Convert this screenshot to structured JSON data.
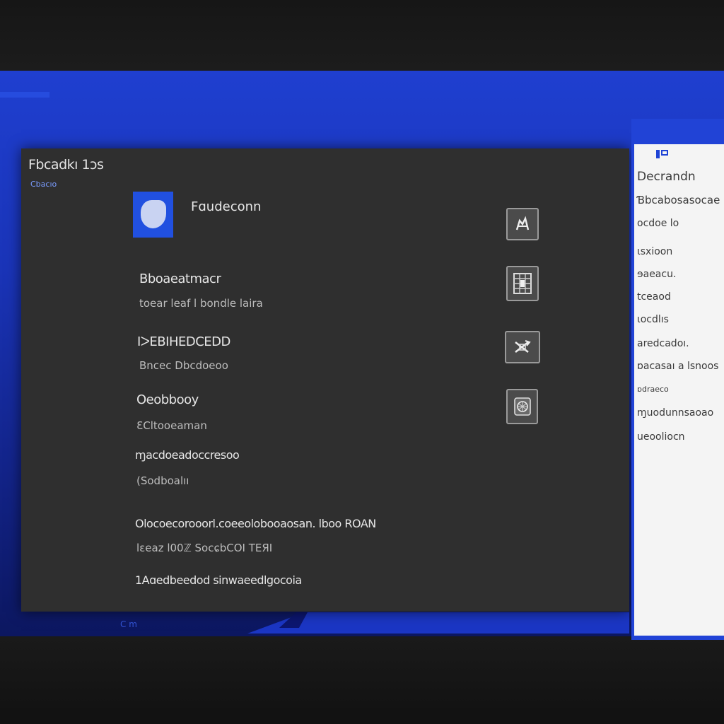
{
  "panel": {
    "title": "Fbcadkı 1ɔs",
    "subtitle": "Cbacıo"
  },
  "account": {
    "name": "Fɑudeconn"
  },
  "rows": [
    {
      "title": "Bboaeatmacr",
      "desc": "toear leaf l bondle laira",
      "icon": "edit-icon"
    },
    {
      "title": "IᐳEBIHEDCEDD",
      "desc": "Bncec Dbcdoeoo",
      "icon": "grid-icon"
    },
    {
      "title": "Oeobbooy",
      "desc": "ƐCltooeaman",
      "icon": "shuffle-icon"
    },
    {
      "title": "ɱacdoeadoccresoo",
      "desc": "(Sodboalıı",
      "icon": ""
    },
    {
      "title": "Olocoecorooorl.coeeolobooaosan. lboo ROAN",
      "desc": "lɛeaz l00ℤ SocɕbCOI TEЯI",
      "icon": ""
    },
    {
      "title": "1Aɑedbeedod sinwaeedlgocoia",
      "desc": "",
      "icon": ""
    }
  ],
  "side": {
    "logo": "logo-icon",
    "items": [
      "Decrandn",
      "Ɓbcabosasocae",
      "ocdoe lo",
      "ɩsxioon",
      "ɘaeacu.",
      "tceaod",
      "ɩocdlıs",
      "aredcadoı.",
      "ɒacasaı a lsnoos",
      "ɒdraeco",
      "ɱuodunnsaoao",
      "ueooliocn"
    ]
  },
  "taskbar": {
    "mark": "C m"
  }
}
